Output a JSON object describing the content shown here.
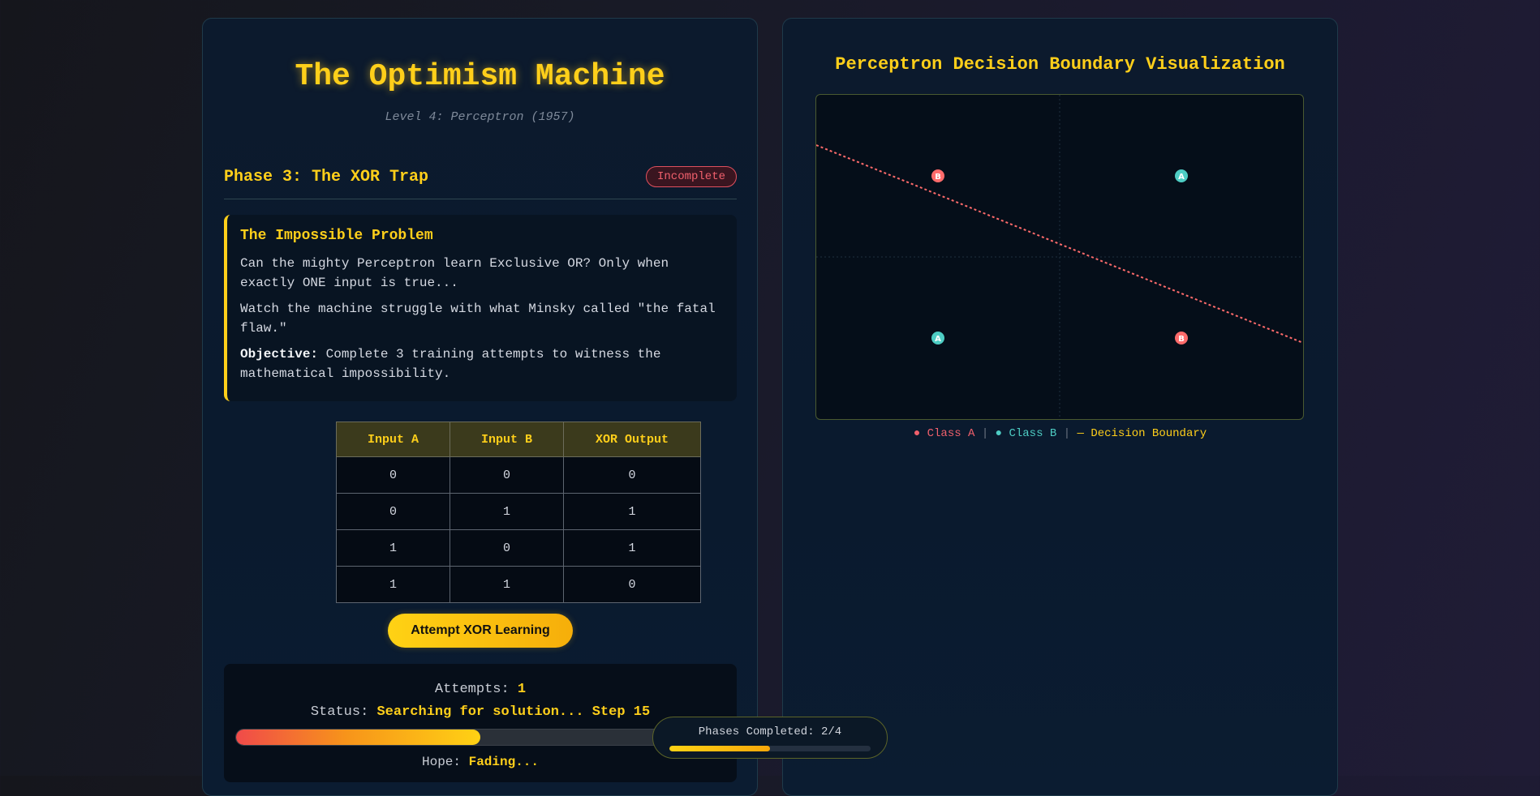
{
  "header": {
    "title": "The Optimism Machine",
    "level": "Level 4: Perceptron (1957)"
  },
  "phase": {
    "title": "Phase 3: The XOR Trap",
    "status_badge": "Incomplete"
  },
  "intro": {
    "heading": "The Impossible Problem",
    "p1": "Can the mighty Perceptron learn Exclusive OR? Only when exactly ONE input is true...",
    "p2": "Watch the machine struggle with what Minsky called \"the fatal flaw.\"",
    "objective_label": "Objective:",
    "objective_text": " Complete 3 training attempts to witness the mathematical impossibility."
  },
  "truth_table": {
    "headers": [
      "Input A",
      "Input B",
      "XOR Output"
    ],
    "rows": [
      [
        "0",
        "0",
        "0"
      ],
      [
        "0",
        "1",
        "1"
      ],
      [
        "1",
        "0",
        "1"
      ],
      [
        "1",
        "1",
        "0"
      ]
    ]
  },
  "action": {
    "button_label": "Attempt XOR Learning"
  },
  "stats": {
    "attempts_label": "Attempts: ",
    "attempts_value": "1",
    "status_label": "Status: ",
    "status_value": "Searching for solution... Step 15",
    "hope_label": "Hope: ",
    "hope_value": "Fading...",
    "hope_fraction": 0.5
  },
  "visualization": {
    "title": "Perceptron Decision Boundary Visualization",
    "points": [
      {
        "x": 0,
        "y": 1,
        "class": "B"
      },
      {
        "x": 1,
        "y": 1,
        "class": "A"
      },
      {
        "x": 0,
        "y": 0,
        "class": "A"
      },
      {
        "x": 1,
        "y": 0,
        "class": "B"
      }
    ],
    "legend": {
      "class_a": "● Class A",
      "class_b": "● Class B",
      "separator": " | ",
      "boundary": "— Decision Boundary"
    },
    "colors": {
      "class_a": "#4ecdc4",
      "class_b": "#ff6b6b",
      "boundary": "#ff6b6b"
    }
  },
  "progress": {
    "phases_label": "Phases Completed: 2/4",
    "completed": 2,
    "total": 4
  }
}
